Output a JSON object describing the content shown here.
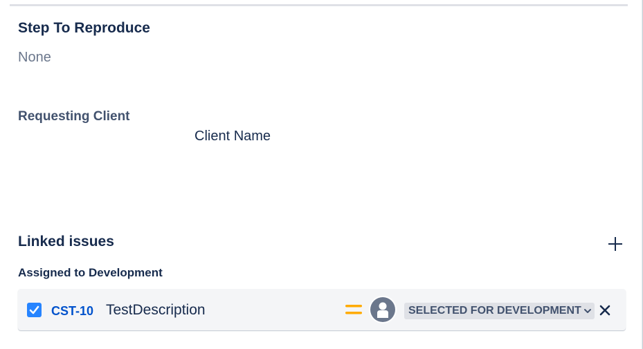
{
  "step_to_reproduce": {
    "label": "Step To Reproduce",
    "value": "None"
  },
  "requesting_client": {
    "label": "Requesting Client",
    "value": "Client Name"
  },
  "linked_issues": {
    "title": "Linked issues",
    "group_label": "Assigned to Development",
    "items": [
      {
        "key": "CST-10",
        "summary": "TestDescription",
        "status": "SELECTED FOR DEVELOPMENT",
        "priority_icon": "priority-medium-icon",
        "assignee_icon": "default-avatar-icon"
      }
    ]
  },
  "colors": {
    "link": "#0052cc",
    "checkbox": "#2684ff",
    "priority_medium": "#ffab00",
    "status_bg": "#dfe1e6"
  }
}
